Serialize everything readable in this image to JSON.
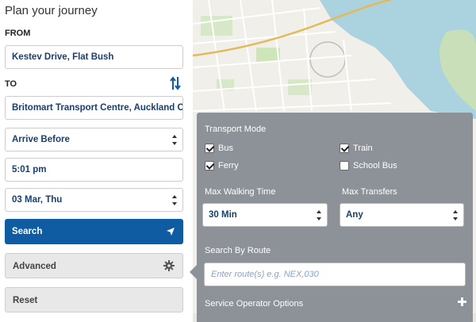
{
  "panel": {
    "title": "Plan your journey",
    "from_label": "FROM",
    "from_value": "Kestev Drive, Flat Bush",
    "to_label": "TO",
    "to_value": "Britomart Transport Centre, Auckland C",
    "time_mode": "Arrive Before",
    "time_value": "5:01 pm",
    "date_value": "03 Mar, Thu",
    "search_label": "Search",
    "advanced_label": "Advanced",
    "reset_label": "Reset"
  },
  "advanced": {
    "transport_mode_label": "Transport Mode",
    "modes": [
      {
        "label": "Bus",
        "checked": true
      },
      {
        "label": "Train",
        "checked": true
      },
      {
        "label": "Ferry",
        "checked": true
      },
      {
        "label": "School Bus",
        "checked": false
      }
    ],
    "max_walking_label": "Max Walking Time",
    "max_walking_value": "30 Min",
    "max_transfers_label": "Max Transfers",
    "max_transfers_value": "Any",
    "route_label": "Search By Route",
    "route_placeholder": "Enter route(s) e.g. NEX,030",
    "operator_label": "Service Operator Options"
  },
  "colors": {
    "primary": "#0f5ca3",
    "popup_bg": "#8d9198",
    "field_text": "#1a3e6e"
  }
}
